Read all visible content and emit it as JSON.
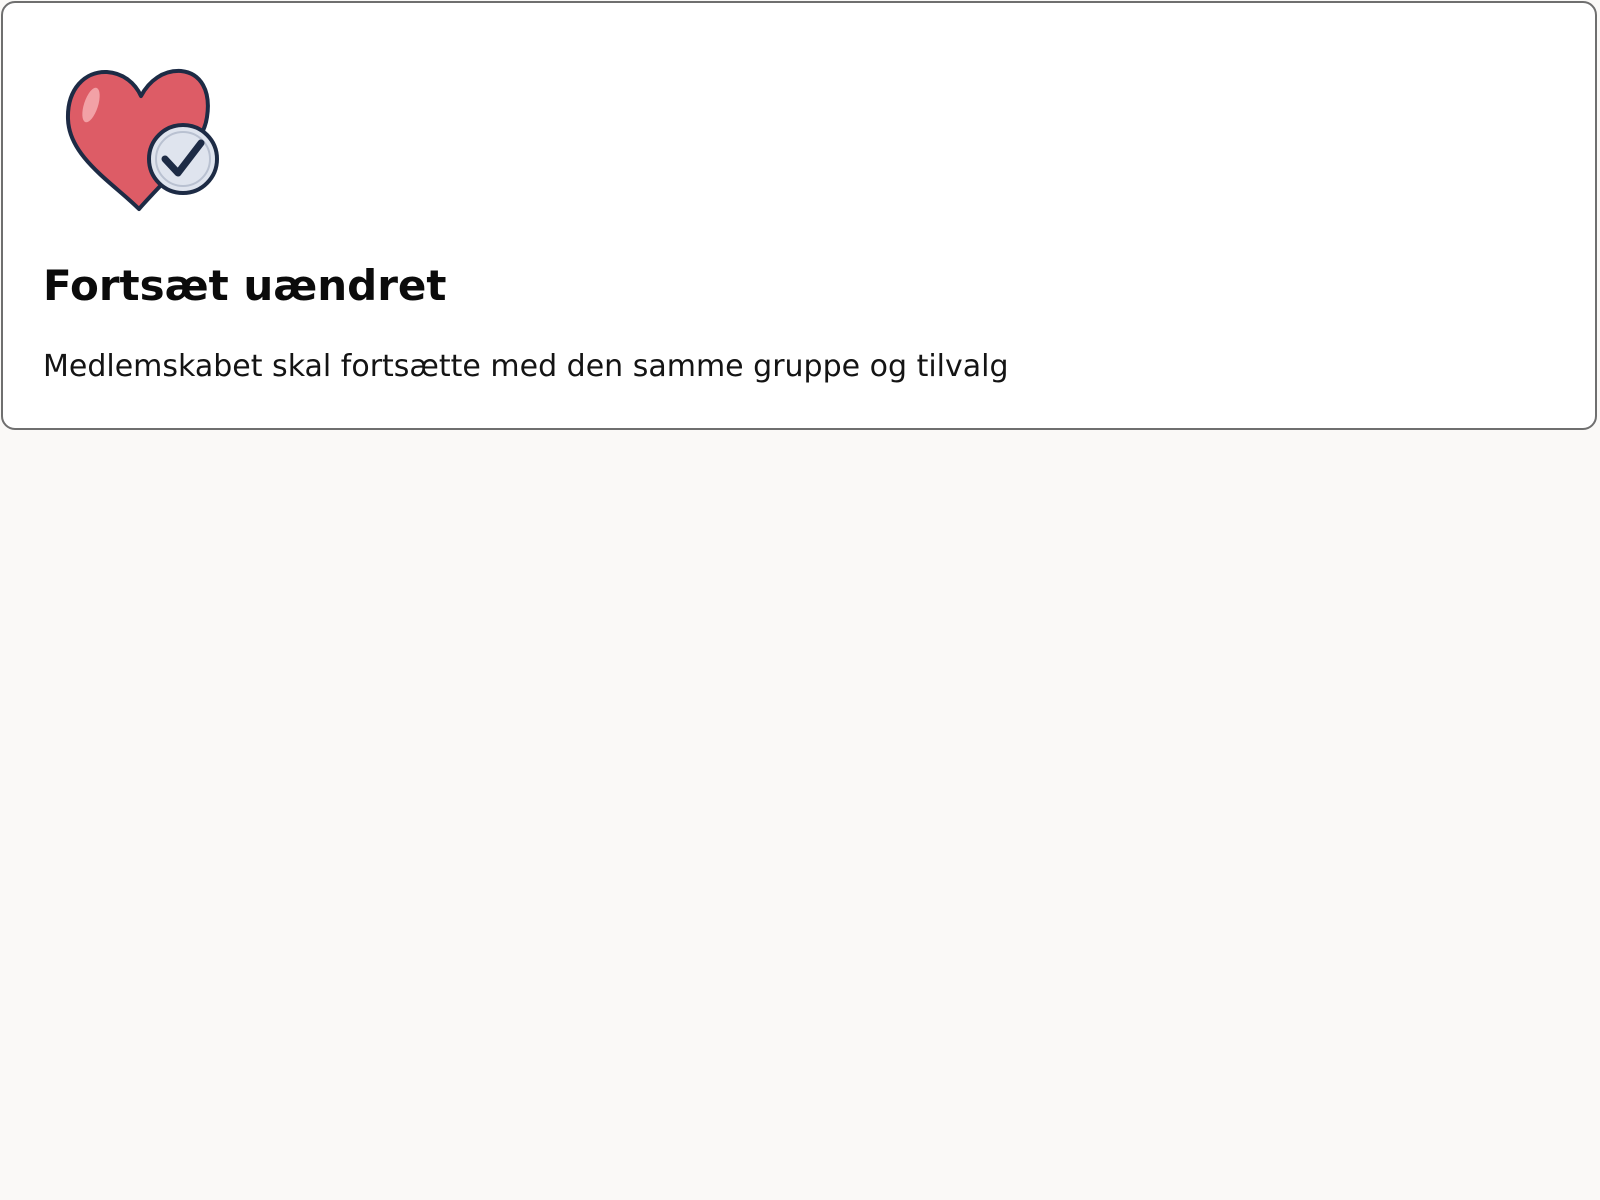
{
  "option": {
    "icon": "heart-check-icon",
    "title": "Fortsæt uændret",
    "description": "Medlemskabet skal fortsætte med den samme gruppe og tilvalg"
  },
  "colors": {
    "page_background": "#faf9f7",
    "card_background": "#ffffff",
    "card_border": "#6f6f6f",
    "heart_fill": "#dd5c66",
    "icon_outline": "#1d2b45",
    "badge_fill": "#dfe4ee"
  }
}
